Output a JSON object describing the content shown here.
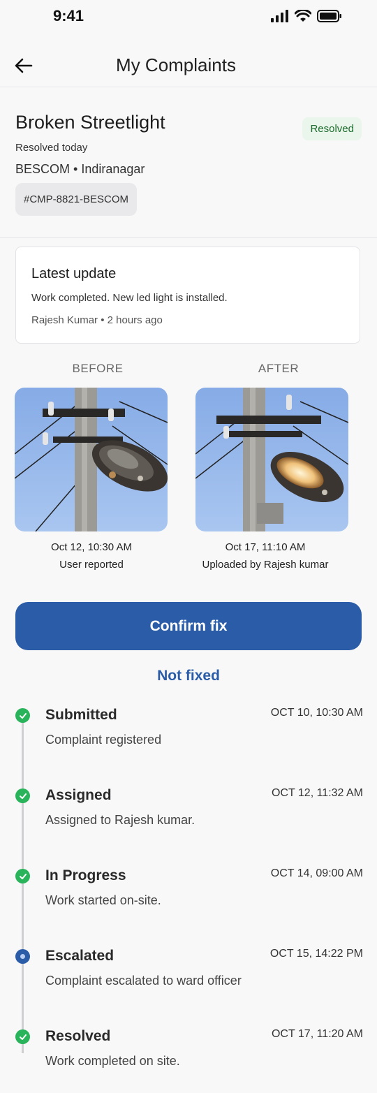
{
  "status_bar": {
    "time": "9:41"
  },
  "nav": {
    "title": "My Complaints",
    "back_icon": "arrow-left-icon"
  },
  "complaint": {
    "title": "Broken Streetlight",
    "status_badge": "Resolved",
    "resolved_text": "Resolved today",
    "meta": "BESCOM • Indiranagar",
    "id": "#CMP-8821-BESCOM"
  },
  "latest_update": {
    "title": "Latest update",
    "text": "Work completed. New led light is installed.",
    "author": "Rajesh Kumar • 2 hours ago"
  },
  "photos": {
    "before": {
      "label": "BEFORE",
      "time": "Oct 12, 10:30 AM",
      "by": "User reported"
    },
    "after": {
      "label": "AFTER",
      "time": "Oct 17, 11:10 AM",
      "by": "Uploaded by Rajesh kumar"
    }
  },
  "actions": {
    "confirm": "Confirm fix",
    "not_fixed": "Not fixed"
  },
  "colors": {
    "primary": "#2a5ca8",
    "success": "#29b35a",
    "badge_bg": "#eaf6ec",
    "badge_text": "#1d6b2d"
  },
  "timeline": [
    {
      "title": "Submitted",
      "time": "OCT 10, 10:30 AM",
      "desc": "Complaint registered",
      "state": "done"
    },
    {
      "title": "Assigned",
      "time": "OCT 12, 11:32 AM",
      "desc": "Assigned to Rajesh kumar.",
      "state": "done"
    },
    {
      "title": "In Progress",
      "time": "OCT 14, 09:00 AM",
      "desc": "Work started on-site.",
      "state": "done"
    },
    {
      "title": "Escalated",
      "time": "OCT 15, 14:22 PM",
      "desc": "Complaint escalated to ward officer",
      "state": "active"
    },
    {
      "title": "Resolved",
      "time": "OCT 17, 11:20 AM",
      "desc": "Work completed on site.",
      "state": "done"
    }
  ]
}
